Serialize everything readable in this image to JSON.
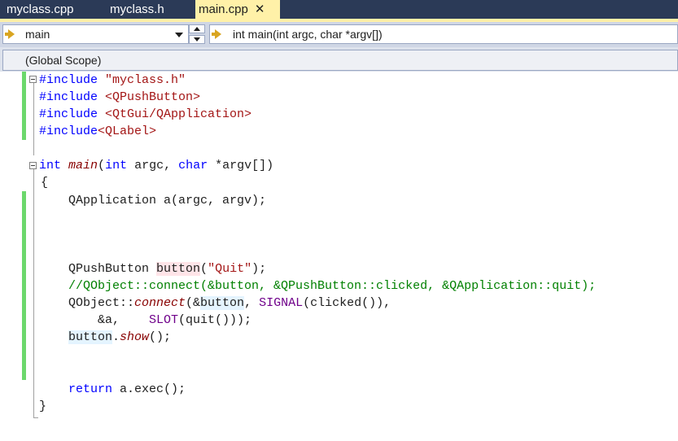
{
  "tabs": [
    {
      "label": "myclass.cpp",
      "active": false
    },
    {
      "label": "myclass.h",
      "active": false
    },
    {
      "label": "main.cpp",
      "active": true,
      "close": "✕"
    }
  ],
  "nav": {
    "left_combo": "main",
    "right_combo": "int main(int argc, char *argv[])"
  },
  "scope": {
    "label": "(Global Scope)"
  },
  "code": {
    "lines": [
      [
        "#include",
        " ",
        "\"myclass.h\""
      ],
      [
        "#include",
        " ",
        "<QPushButton>"
      ],
      [
        "#include",
        " ",
        "<QtGui/QApplication>"
      ],
      [
        "#include",
        "<QLabel>"
      ],
      [
        "int",
        " ",
        "main",
        "(",
        "int",
        " argc, ",
        "char",
        " *argv[])"
      ],
      [
        "{"
      ],
      [
        "QApplication a(argc, argv);"
      ],
      [
        "QPushButton ",
        "button",
        "(",
        "\"Quit\"",
        ");"
      ],
      [
        "//QObject::connect(&button, &QPushButton::clicked, &QApplication::quit);"
      ],
      [
        "QObject::",
        "connect",
        "(&",
        "button",
        ", ",
        "SIGNAL",
        "(clicked()),"
      ],
      [
        "&a,",
        "SLOT",
        "(quit()));"
      ],
      [
        "button",
        ".",
        "show",
        "();"
      ],
      [
        "return",
        " a.exec();"
      ],
      [
        "}"
      ]
    ]
  },
  "colors": {
    "tab_bar": "#2b3a57",
    "active_tab": "#fff1a8",
    "keyword": "#0000ff",
    "string": "#a31515",
    "comment": "#008000",
    "macro": "#6f008a",
    "change_marker": "#6cd86c"
  }
}
